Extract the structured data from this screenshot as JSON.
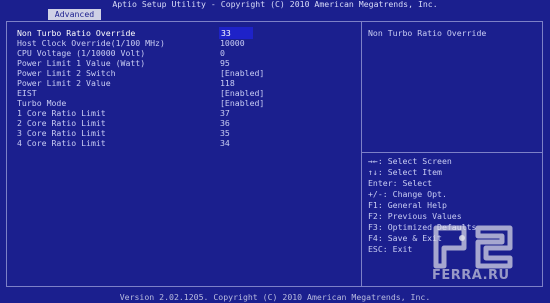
{
  "window": {
    "title": "Aptio Setup Utility - Copyright (C) 2010 American Megatrends, Inc."
  },
  "tabs": [
    {
      "label": "Advanced",
      "active": true
    }
  ],
  "settings": [
    {
      "label": "Non Turbo Ratio Override",
      "value": "33",
      "selected": true
    },
    {
      "label": "Host Clock Override(1/100 MHz)",
      "value": "10000"
    },
    {
      "label": "CPU Voltage (1/10000 Volt)",
      "value": "0"
    },
    {
      "label": "Power Limit 1 Value (Watt)",
      "value": "95"
    },
    {
      "label": "Power Limit 2 Switch",
      "value": "[Enabled]"
    },
    {
      "label": "Power Limit 2 Value",
      "value": "118"
    },
    {
      "label": "EIST",
      "value": "[Enabled]"
    },
    {
      "label": "Turbo Mode",
      "value": "[Enabled]"
    },
    {
      "label": "1 Core Ratio Limit",
      "value": "37"
    },
    {
      "label": "2 Core Ratio Limit",
      "value": "36"
    },
    {
      "label": "3 Core Ratio Limit",
      "value": "35"
    },
    {
      "label": "4 Core Ratio Limit",
      "value": "34"
    }
  ],
  "help": {
    "title": "Non Turbo Ratio Override"
  },
  "keys": [
    {
      "text": "→←: Select Screen"
    },
    {
      "text": "↑↓: Select Item"
    },
    {
      "text": "Enter: Select"
    },
    {
      "text": "+/-: Change Opt."
    },
    {
      "text": "F1: General Help"
    },
    {
      "text": "F2: Previous Values"
    },
    {
      "text": "F3: Optimized Defaults"
    },
    {
      "text": "F4: Save & Exit"
    },
    {
      "text": "ESC: Exit"
    }
  ],
  "footer": {
    "version": "Version 2.02.1205. Copyright (C) 2010 American Megatrends, Inc."
  },
  "watermark": {
    "text": "FERRA.RU"
  },
  "colors": {
    "background": "#1b1f8e",
    "selected_value_bg": "#1e22c8",
    "tab_bg": "#cfd1e6",
    "text": "#c9cdf4"
  }
}
